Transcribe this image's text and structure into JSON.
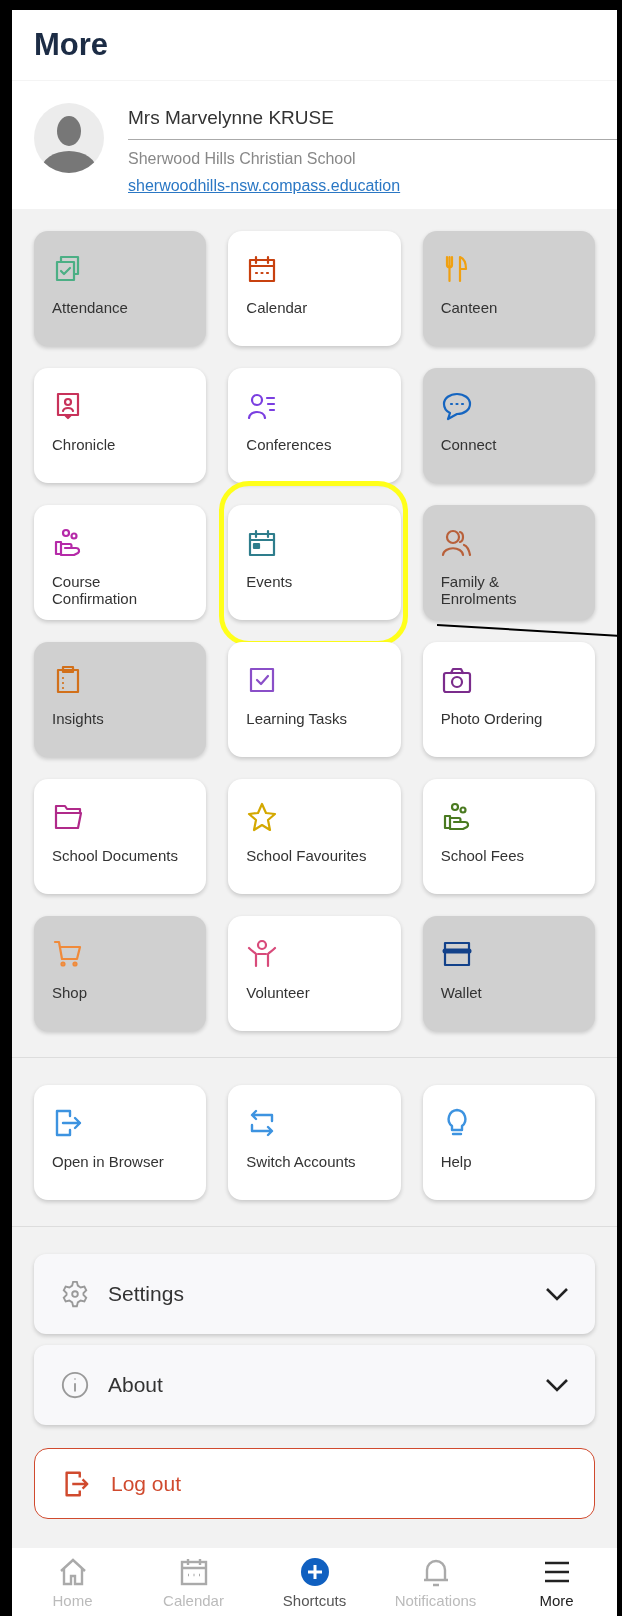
{
  "header": {
    "title": "More"
  },
  "profile": {
    "name": "Mrs Marvelynne KRUSE",
    "school": "Sherwood Hills Christian School",
    "link": "sherwoodhills-nsw.compass.education"
  },
  "tiles": [
    {
      "label": "Attendance",
      "color": "#4caf85",
      "disabled": true,
      "highlighted": false
    },
    {
      "label": "Calendar",
      "color": "#c8410f",
      "disabled": false,
      "highlighted": false
    },
    {
      "label": "Canteen",
      "color": "#f0a010",
      "disabled": true,
      "highlighted": false
    },
    {
      "label": "Chronicle",
      "color": "#c8325a",
      "disabled": false,
      "highlighted": false
    },
    {
      "label": "Conferences",
      "color": "#7a3ee0",
      "disabled": false,
      "highlighted": false
    },
    {
      "label": "Connect",
      "color": "#1565c0",
      "disabled": true,
      "highlighted": false
    },
    {
      "label": "Course Confirmation",
      "color": "#b52aa8",
      "disabled": false,
      "highlighted": false
    },
    {
      "label": "Events",
      "color": "#2e7d8c",
      "disabled": false,
      "highlighted": true
    },
    {
      "label": "Family & Enrolments",
      "color": "#b8603a",
      "disabled": true,
      "highlighted": false
    },
    {
      "label": "Insights",
      "color": "#d2701a",
      "disabled": true,
      "highlighted": false
    },
    {
      "label": "Learning Tasks",
      "color": "#8a4fc8",
      "disabled": false,
      "highlighted": false
    },
    {
      "label": "Photo Ordering",
      "color": "#7b2c8c",
      "disabled": false,
      "highlighted": false
    },
    {
      "label": "School Documents",
      "color": "#b02a8a",
      "disabled": false,
      "highlighted": false
    },
    {
      "label": "School Favourites",
      "color": "#d4a800",
      "disabled": false,
      "highlighted": false
    },
    {
      "label": "School Fees",
      "color": "#4a7a20",
      "disabled": false,
      "highlighted": false
    },
    {
      "label": "Shop",
      "color": "#f08a3a",
      "disabled": true,
      "highlighted": false
    },
    {
      "label": "Volunteer",
      "color": "#d84a7a",
      "disabled": false,
      "highlighted": false
    },
    {
      "label": "Wallet",
      "color": "#12418a",
      "disabled": true,
      "highlighted": false
    }
  ],
  "links": [
    {
      "label": "Open in Browser"
    },
    {
      "label": "Switch Accounts"
    },
    {
      "label": "Help"
    }
  ],
  "accordions": [
    {
      "label": "Settings",
      "expanded": false
    },
    {
      "label": "About",
      "expanded": false
    }
  ],
  "logout": {
    "label": "Log out"
  },
  "nav": [
    {
      "label": "Home",
      "selected": false
    },
    {
      "label": "Calendar",
      "selected": false
    },
    {
      "label": "Shortcuts",
      "selected": false
    },
    {
      "label": "Notifications",
      "selected": false
    },
    {
      "label": "More",
      "selected": true
    }
  ]
}
